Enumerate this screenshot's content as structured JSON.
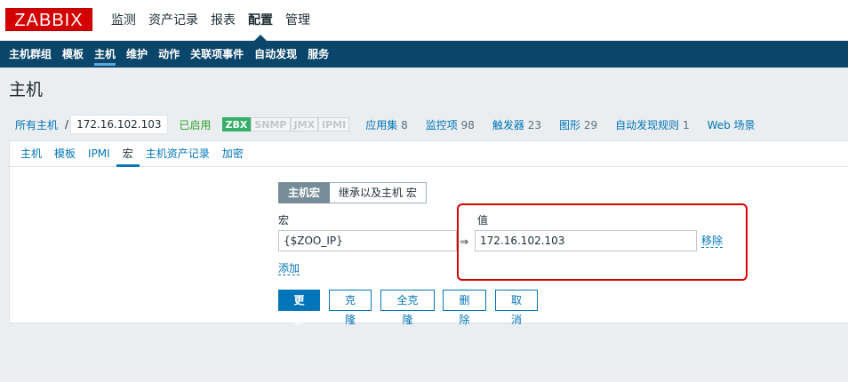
{
  "header": {
    "logo": "ZABBIX",
    "menu": [
      "监测",
      "资产记录",
      "报表",
      "配置",
      "管理"
    ],
    "active_menu_index": 3
  },
  "subnav": {
    "items": [
      "主机群组",
      "模板",
      "主机",
      "维护",
      "动作",
      "关联项事件",
      "自动发现",
      "服务"
    ],
    "active_index": 2
  },
  "page": {
    "title": "主机"
  },
  "breadcrumb": {
    "all_hosts": "所有主机",
    "separator": "/",
    "current_host": "172.16.102.103",
    "status": "已启用",
    "availability": [
      "ZBX",
      "SNMP",
      "JMX",
      "IPMI"
    ],
    "stats": [
      {
        "label": "应用集",
        "count": "8"
      },
      {
        "label": "监控项",
        "count": "98"
      },
      {
        "label": "触发器",
        "count": "23"
      },
      {
        "label": "图形",
        "count": "29"
      },
      {
        "label": "自动发现规则",
        "count": "1"
      },
      {
        "label": "Web 场景",
        "count": ""
      }
    ]
  },
  "tabs": {
    "items": [
      "主机",
      "模板",
      "IPMI",
      "宏",
      "主机资产记录",
      "加密"
    ],
    "active_index": 3
  },
  "macros": {
    "toggle": {
      "host_macros": "主机宏",
      "inherited": "继承以及主机 宏"
    },
    "macro_label": "宏",
    "value_label": "值",
    "macro_value": "{$ZOO_IP}",
    "value_value": "172.16.102.103",
    "arrow": "⇒",
    "remove": "移除",
    "add": "添加"
  },
  "actions": {
    "update": "更新",
    "clone": "克隆",
    "full_clone": "全克隆",
    "delete": "删除",
    "cancel": "取消"
  },
  "colors": {
    "brand": "#d40000",
    "nav": "#0a466a",
    "link": "#0275b8",
    "enabled": "#2da12d",
    "zbx_available": "#34af67"
  }
}
